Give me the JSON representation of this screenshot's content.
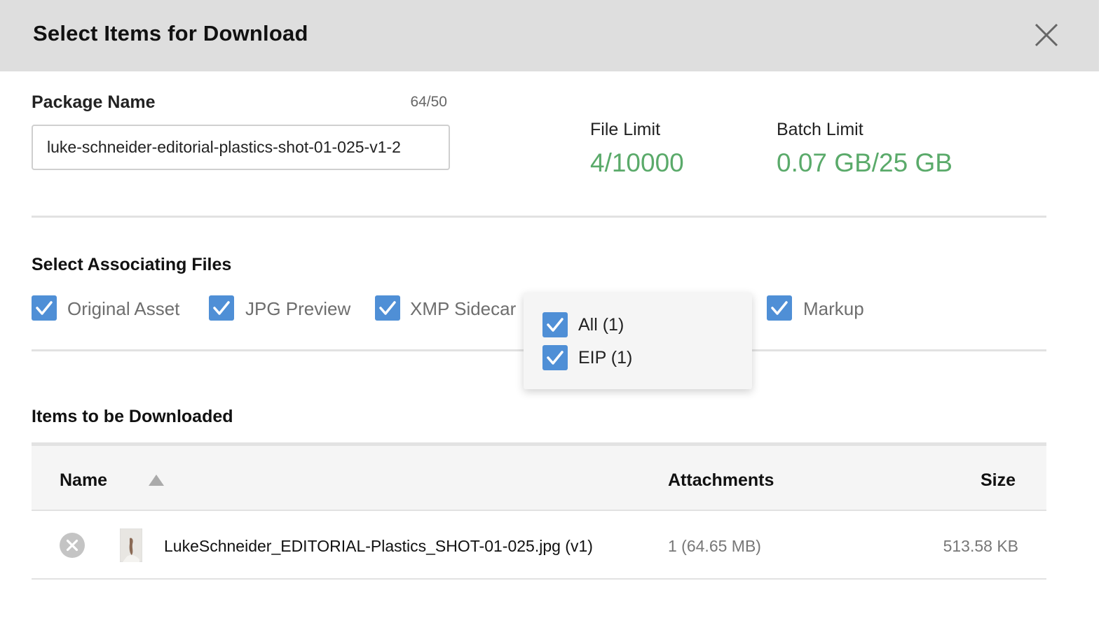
{
  "dialog": {
    "title": "Select Items for Download",
    "close_icon": "close-icon"
  },
  "package": {
    "label": "Package Name",
    "count": "64/50",
    "value": "luke-schneider-editorial-plastics-shot-01-025-v1-2"
  },
  "limits": {
    "file_label": "File Limit",
    "file_value": "4/10000",
    "batch_label": "Batch Limit",
    "batch_value": "0.07 GB/25 GB",
    "value_color": "#5aaa6a"
  },
  "associating": {
    "title": "Select Associating Files",
    "options": [
      {
        "label": "Original Asset",
        "checked": true
      },
      {
        "label": "JPG Preview",
        "checked": true
      },
      {
        "label": "XMP Sidecar",
        "checked": true
      },
      {
        "label": "Markup",
        "checked": true
      }
    ],
    "dropdown": [
      {
        "label": "All (1)",
        "checked": true
      },
      {
        "label": "EIP (1)",
        "checked": true
      }
    ],
    "checkbox_color": "#4f8fd6"
  },
  "items": {
    "title": "Items to be Downloaded",
    "columns": {
      "name": "Name",
      "attachments": "Attachments",
      "size": "Size"
    },
    "sort": "ascending",
    "rows": [
      {
        "name": "LukeSchneider_EDITORIAL-Plastics_SHOT-01-025.jpg (v1)",
        "attachments": "1 (64.65 MB)",
        "size": "513.58 KB"
      }
    ]
  }
}
